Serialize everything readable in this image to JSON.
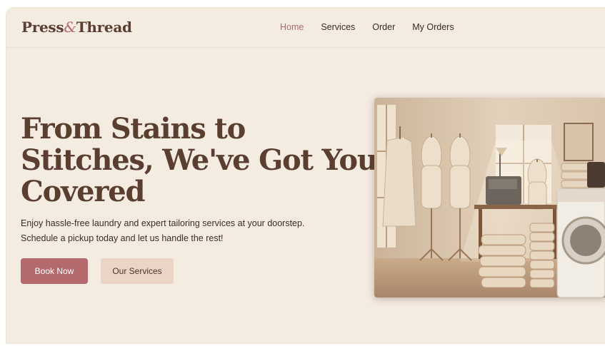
{
  "brand": {
    "name_part1": "Press",
    "name_amp": "&",
    "name_part2": "Thread"
  },
  "nav": {
    "items": [
      {
        "label": "Home",
        "active": true
      },
      {
        "label": "Services",
        "active": false
      },
      {
        "label": "Order",
        "active": false
      },
      {
        "label": "My Orders",
        "active": false
      }
    ]
  },
  "hero": {
    "title_line1": "From Stains to",
    "title_line2": "Stitches, We've Got You",
    "title_line3": "Covered",
    "subtitle_line1": "Enjoy hassle-free laundry and expert tailoring services at your doorstep.",
    "subtitle_line2": "Schedule a pickup today and let us handle the rest!",
    "primary_button": "Book Now",
    "secondary_button": "Our Services"
  },
  "colors": {
    "background": "#f4ebe1",
    "brand_brown": "#5a3e2f",
    "accent_rose": "#b46a6c",
    "secondary_button_bg": "#e9d4c5"
  }
}
